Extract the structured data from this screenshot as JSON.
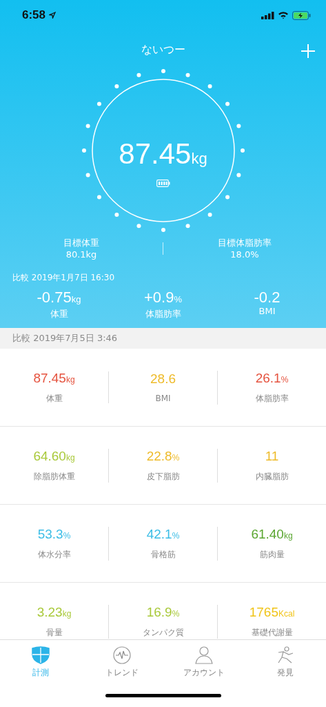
{
  "status_bar": {
    "time": "6:58"
  },
  "header": {
    "title": "ないつー",
    "weight": {
      "value": "87.45",
      "unit": "kg"
    },
    "goals": [
      {
        "label": "目標体重",
        "value": "80.1kg"
      },
      {
        "label": "目標体脂肪率",
        "value": "18.0%"
      }
    ],
    "compare": {
      "label": "比較 2019年1月7日 16:30",
      "items": [
        {
          "value": "-0.75",
          "unit": "kg",
          "label": "体重"
        },
        {
          "value": "+0.9",
          "unit": "%",
          "label": "体脂肪率"
        },
        {
          "value": "-0.2",
          "label": "BMI"
        }
      ]
    }
  },
  "section_label": "比較 2019年7月5日 3:46",
  "metrics": [
    [
      {
        "value": "87.45",
        "unit": "kg",
        "label": "体重",
        "color": "#e5533f"
      },
      {
        "value": "28.6",
        "label": "BMI",
        "color": "#eebb2b"
      },
      {
        "value": "26.1",
        "unit": "%",
        "label": "体脂肪率",
        "color": "#e5533f"
      }
    ],
    [
      {
        "value": "64.60",
        "unit": "kg",
        "label": "除脂肪体重",
        "color": "#a9c93a"
      },
      {
        "value": "22.8",
        "unit": "%",
        "label": "皮下脂肪",
        "color": "#eebb2b"
      },
      {
        "value": "11",
        "label": "内臓脂肪",
        "color": "#eebb2b"
      }
    ],
    [
      {
        "value": "53.3",
        "unit": "%",
        "label": "体水分率",
        "color": "#3cbde6"
      },
      {
        "value": "42.1",
        "unit": "%",
        "label": "骨格筋",
        "color": "#3cbde6"
      },
      {
        "value": "61.40",
        "unit": "kg",
        "label": "筋肉量",
        "color": "#5aa630"
      }
    ],
    [
      {
        "value": "3.23",
        "unit": "kg",
        "label": "骨量",
        "color": "#a9c93a"
      },
      {
        "value": "16.9",
        "unit": "%",
        "label": "タンパク質",
        "color": "#a9c93a"
      },
      {
        "value": "1765",
        "unit": "Kcal",
        "label": "基礎代謝量",
        "color": "#f0c419"
      }
    ]
  ],
  "tabs": [
    {
      "label": "計測",
      "kind": "shield",
      "selected": true
    },
    {
      "label": "トレンド",
      "kind": "pulse",
      "selected": false
    },
    {
      "label": "アカウント",
      "kind": "person",
      "selected": false
    },
    {
      "label": "発見",
      "kind": "runner",
      "selected": false
    }
  ]
}
